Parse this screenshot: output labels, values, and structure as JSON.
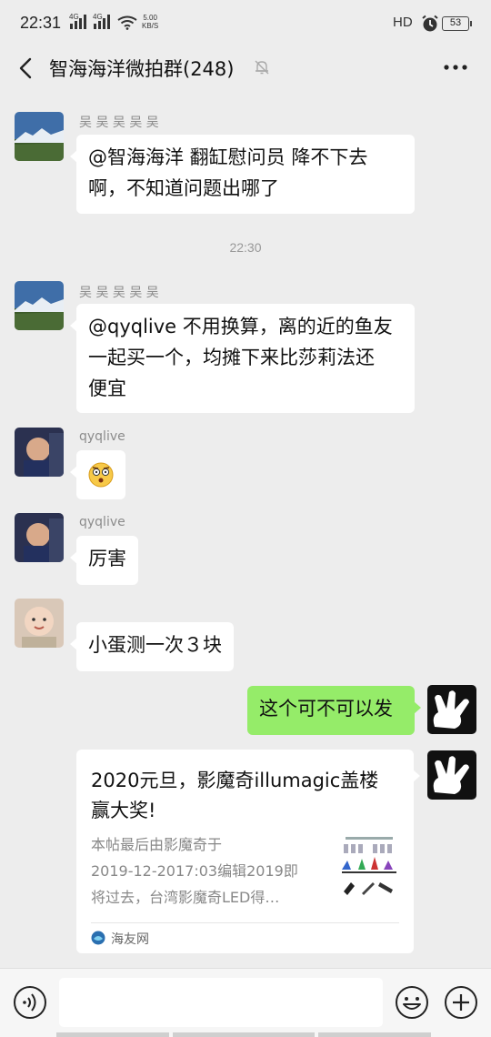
{
  "status_bar": {
    "time": "22:31",
    "net1": "4G",
    "net2": "4G",
    "speed_value": "5.00",
    "speed_unit": "KB/S",
    "hd_label": "HD",
    "battery": "53"
  },
  "header": {
    "title": "智海海洋微拍群(248)",
    "back_icon": "chevron-left-icon",
    "mute_icon": "bell-off-icon",
    "more_icon": "more-dots-icon"
  },
  "messages": [
    {
      "sender": "吴 吴 吴 吴 吴",
      "text_line1": "@智海海洋 翻缸慰问员  降不下去",
      "text_line2": "啊，不知道问题出哪了"
    },
    {
      "timestamp": "22:30"
    },
    {
      "sender": "吴 吴 吴 吴 吴",
      "text_line1": "@qyqlive 不用换算，离的近的鱼友",
      "text_line2": "一起买一个，均摊下来比莎莉法还",
      "text_line3": "便宜"
    },
    {
      "sender": "qyqlive",
      "emoji": "dizzy-face-emoji"
    },
    {
      "sender": "qyqlive",
      "text": "厉害"
    },
    {
      "text": "小蛋测一次３块"
    },
    {
      "text": "这个可不可以发",
      "outgoing": true
    }
  ],
  "link_card": {
    "title_line1": "2020元旦，影魔奇illumagic盖楼",
    "title_line2": "赢大奖!",
    "desc_line1": "本帖最后由影魔奇于",
    "desc_line2": "2019-12-2017:03编辑2019即",
    "desc_line3": "将过去，台湾影魔奇LED得…",
    "source": "海友网"
  },
  "input_bar": {
    "placeholder": "",
    "voice_icon": "voice-icon",
    "emoji_icon": "emoji-icon",
    "plus_icon": "plus-icon"
  },
  "colors": {
    "background": "#ededed",
    "incoming_bubble": "#ffffff",
    "outgoing_bubble": "#95ec69"
  }
}
